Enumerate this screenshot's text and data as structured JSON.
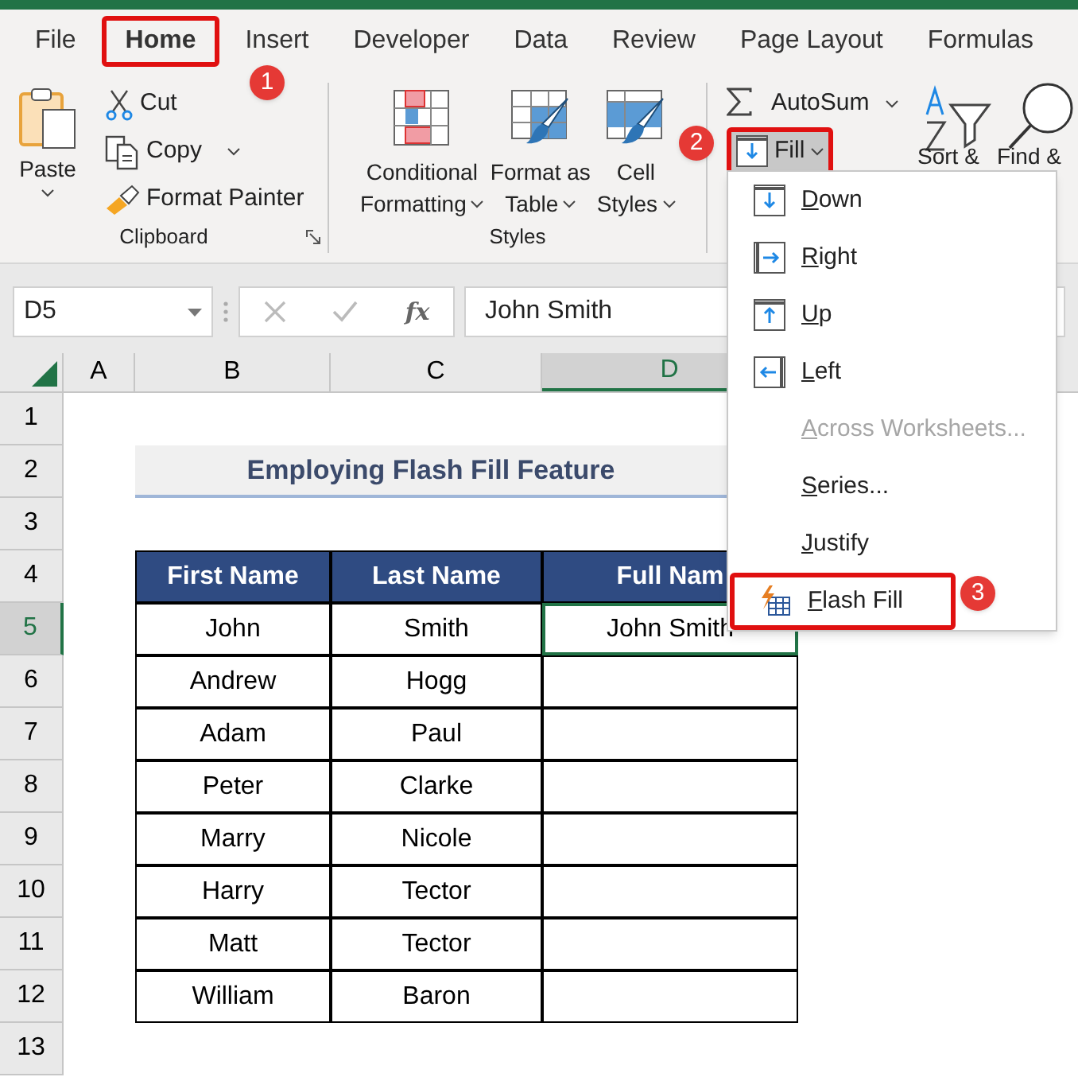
{
  "tabs": [
    {
      "label": "File",
      "selected": false
    },
    {
      "label": "Home",
      "selected": true
    },
    {
      "label": "Insert",
      "selected": false
    },
    {
      "label": "Developer",
      "selected": false
    },
    {
      "label": "Data",
      "selected": false
    },
    {
      "label": "Review",
      "selected": false
    },
    {
      "label": "Page Layout",
      "selected": false
    },
    {
      "label": "Formulas",
      "selected": false
    }
  ],
  "clipboard": {
    "paste": "Paste",
    "items": [
      {
        "kind": "cut",
        "label": "Cut"
      },
      {
        "kind": "copy",
        "label": "Copy"
      },
      {
        "kind": "painter",
        "label": "Format Painter"
      }
    ],
    "group_label": "Clipboard"
  },
  "styles": {
    "buttons": [
      {
        "kind": "conditional",
        "lines": [
          "Conditional",
          "Formatting"
        ]
      },
      {
        "kind": "table",
        "lines": [
          "Format as",
          "Table"
        ]
      },
      {
        "kind": "cell",
        "lines": [
          "Cell",
          "Styles"
        ]
      }
    ],
    "group_label": "Styles"
  },
  "editing": {
    "autosum": "AutoSum",
    "fill": "Fill",
    "sort": "Sort &",
    "find": "Find &"
  },
  "formula_bar": {
    "name_box": "D5",
    "fx": "fx",
    "value": "John Smith"
  },
  "columns": [
    {
      "label": "A",
      "selected": false
    },
    {
      "label": "B",
      "selected": false
    },
    {
      "label": "C",
      "selected": false
    },
    {
      "label": "D",
      "selected": true
    }
  ],
  "row_numbers": [
    {
      "label": "1",
      "selected": false
    },
    {
      "label": "2",
      "selected": false
    },
    {
      "label": "3",
      "selected": false
    },
    {
      "label": "4",
      "selected": false
    },
    {
      "label": "5",
      "selected": true
    },
    {
      "label": "6",
      "selected": false
    },
    {
      "label": "7",
      "selected": false
    },
    {
      "label": "8",
      "selected": false
    },
    {
      "label": "9",
      "selected": false
    },
    {
      "label": "10",
      "selected": false
    },
    {
      "label": "11",
      "selected": false
    },
    {
      "label": "12",
      "selected": false
    },
    {
      "label": "13",
      "selected": false
    }
  ],
  "table": {
    "title": "Employing Flash Fill Feature",
    "headers": [
      "First Name",
      "Last Name",
      "Full Nam"
    ],
    "rows": [
      [
        "John",
        "Smith",
        "John Smith"
      ],
      [
        "Andrew",
        "Hogg",
        ""
      ],
      [
        "Adam",
        "Paul",
        ""
      ],
      [
        "Peter",
        "Clarke",
        ""
      ],
      [
        "Marry",
        "Nicole",
        ""
      ],
      [
        "Harry",
        "Tector",
        ""
      ],
      [
        "Matt",
        "Tector",
        ""
      ],
      [
        "William",
        "Baron",
        ""
      ]
    ]
  },
  "fill_menu": {
    "items": [
      {
        "kind": "down",
        "label": "Down",
        "disabled": false,
        "highlighted": false
      },
      {
        "kind": "right",
        "label": "Right",
        "disabled": false,
        "highlighted": false
      },
      {
        "kind": "up",
        "label": "Up",
        "disabled": false,
        "highlighted": false
      },
      {
        "kind": "left",
        "label": "Left",
        "disabled": false,
        "highlighted": false
      },
      {
        "kind": "plain",
        "label": "Across Worksheets...",
        "disabled": true,
        "highlighted": false
      },
      {
        "kind": "plain",
        "label": "Series...",
        "disabled": false,
        "highlighted": false
      },
      {
        "kind": "plain",
        "label": "Justify",
        "disabled": false,
        "highlighted": false
      },
      {
        "kind": "flash",
        "label": "Flash Fill",
        "disabled": false,
        "highlighted": true
      }
    ]
  },
  "step_badges": [
    "1",
    "2",
    "3"
  ]
}
